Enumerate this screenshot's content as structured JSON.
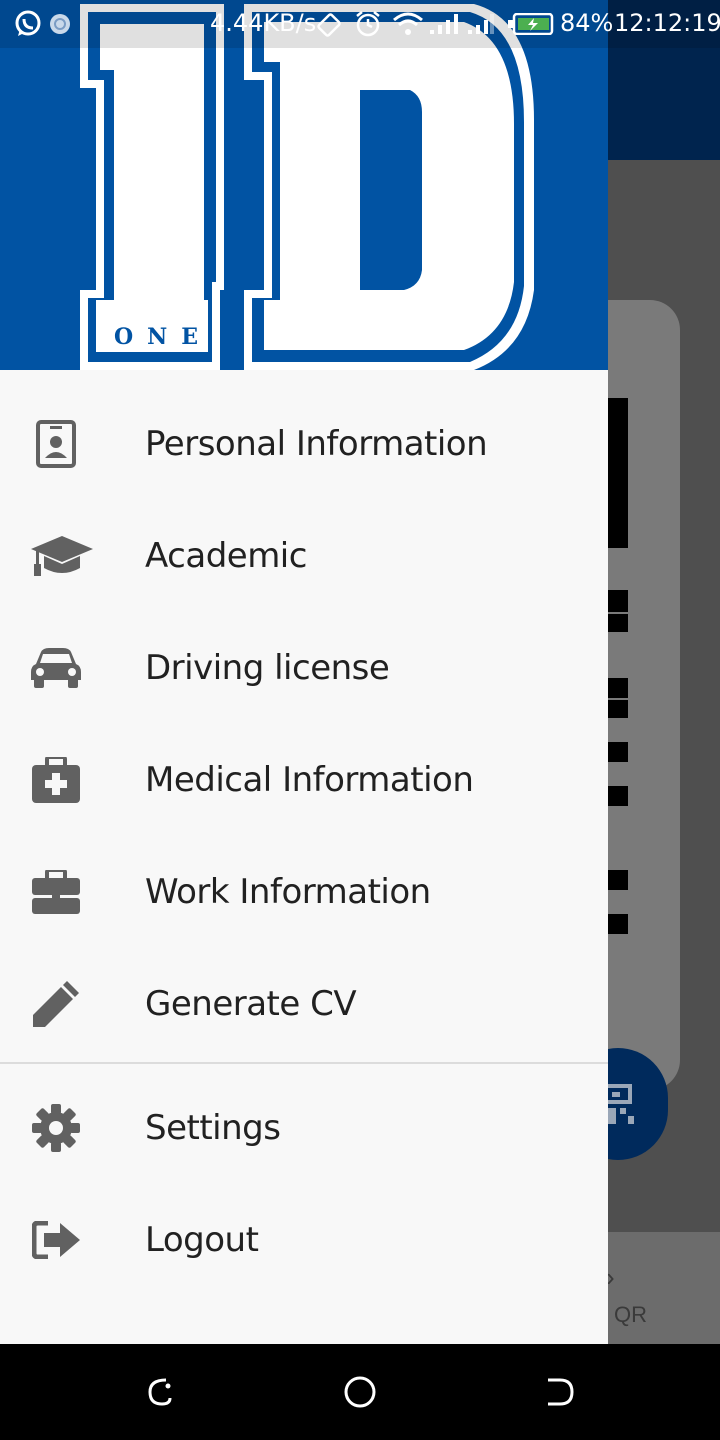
{
  "status_bar": {
    "net_speed": "4.44KB/s",
    "battery": "84%",
    "time": "12:12:19",
    "icons": [
      "whatsapp-icon",
      "sync-icon",
      "rotate-icon",
      "alarm-icon",
      "wifi-icon",
      "signal-icon",
      "signal-icon",
      "battery-charging-icon"
    ]
  },
  "drawer": {
    "logo_small_text": "ONE",
    "logo_text": "1D",
    "items": [
      {
        "label": "Personal Information",
        "icon": "id-card-icon"
      },
      {
        "label": "Academic",
        "icon": "graduation-cap-icon"
      },
      {
        "label": "Driving license",
        "icon": "car-icon"
      },
      {
        "label": "Medical Information",
        "icon": "medical-kit-icon"
      },
      {
        "label": "Work Information",
        "icon": "briefcase-icon"
      },
      {
        "label": "Generate CV",
        "icon": "pencil-icon"
      }
    ],
    "secondary_items": [
      {
        "label": "Settings",
        "icon": "gear-icon"
      },
      {
        "label": "Logout",
        "icon": "logout-icon"
      }
    ]
  },
  "background_app": {
    "bottom_tab_label": "QR"
  },
  "colors": {
    "header_blue": "#0153a3",
    "toolbar_dark": "#00244e",
    "icon_gray": "#5f6368",
    "text": "#212121"
  },
  "nav_bar": {
    "buttons": [
      "back-icon",
      "home-icon",
      "recents-icon"
    ]
  }
}
